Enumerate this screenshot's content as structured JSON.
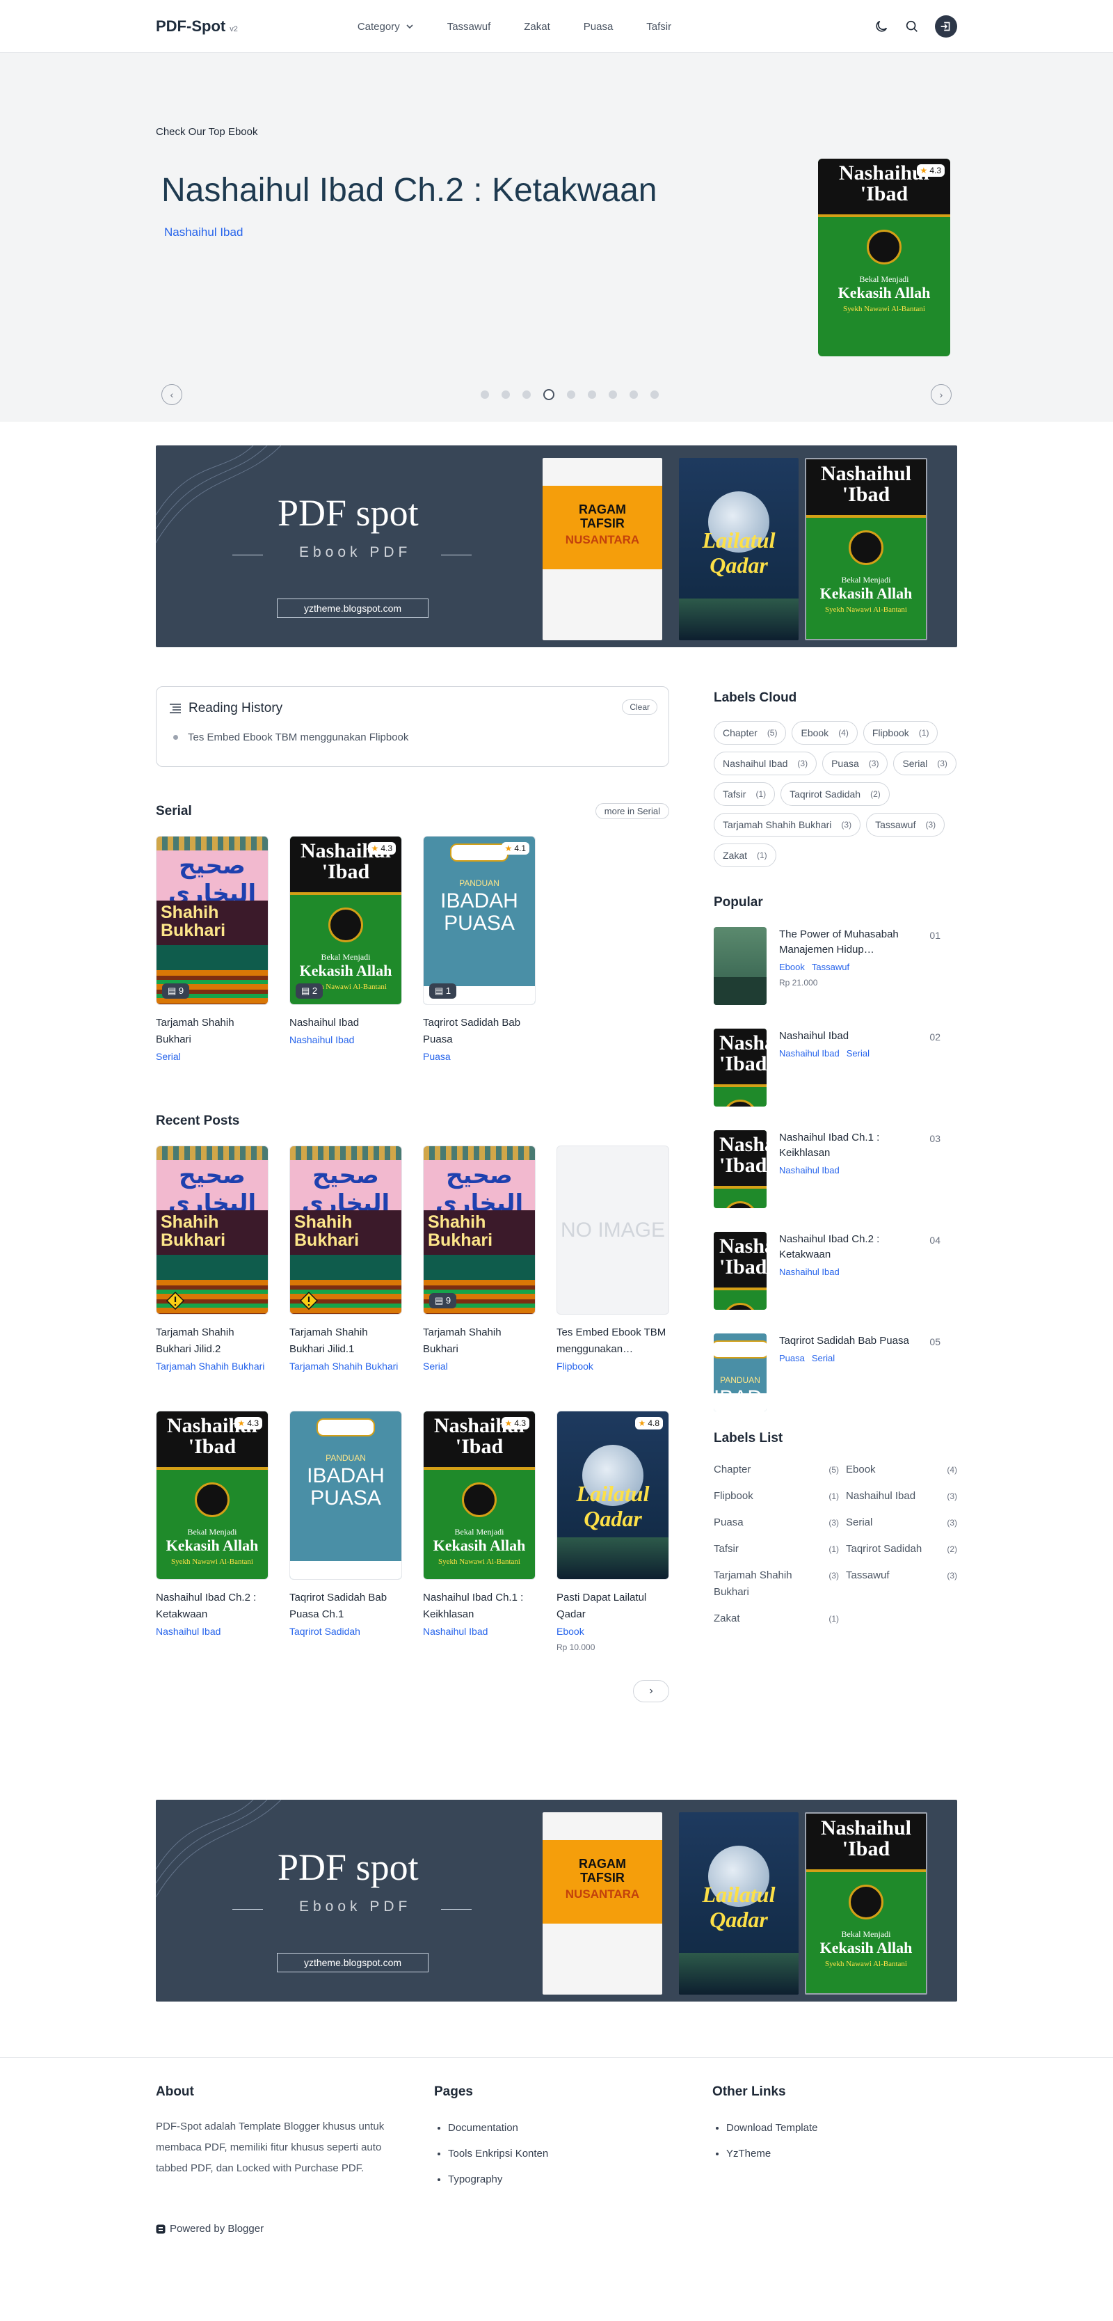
{
  "header": {
    "logo": "PDF-Spot",
    "version": "v2",
    "nav": [
      "Category",
      "Tassawuf",
      "Zakat",
      "Puasa",
      "Tafsir"
    ]
  },
  "hero": {
    "kicker": "Check Our Top Ebook",
    "title": "Nashaihul Ibad Ch.2 : Ketakwaan",
    "label": "Nashaihul Ibad",
    "rating": "4.3",
    "slides": 9,
    "active_slide": 4
  },
  "banner": {
    "title": "PDF spot",
    "subtitle": "Ebook PDF",
    "url": "yztheme.blogspot.com"
  },
  "covers": {
    "bukhari_top": "صحيح البخاري",
    "bukhari_name": "Shahih Bukhari",
    "nashaihul": "Nashaihul 'Ibad",
    "nashaihul_sub": "Bekal Menjadi",
    "nashaihul_main": "Kekasih Allah",
    "nashaihul_author": "Syekh Nawawi Al-Bantani",
    "puasa_small": "PANDUAN",
    "puasa_big1": "IBADAH",
    "puasa_big2": "PUASA",
    "lailatul1": "Lailatul",
    "lailatul2": "Qadar",
    "ragam": "RAGAM TAFSIR",
    "nusantara": "NUSANTARA",
    "no_image": "NO IMAGE"
  },
  "reading_history": {
    "title": "Reading History",
    "clear": "Clear",
    "items": [
      "Tes Embed Ebook TBM menggunakan Flipbook"
    ]
  },
  "serial": {
    "title": "Serial",
    "more": "more in Serial",
    "items": [
      {
        "title": "Tarjamah Shahih Bukhari",
        "label": "Serial",
        "count": "9"
      },
      {
        "title": "Nashaihul Ibad",
        "label": "Nashaihul Ibad",
        "count": "2",
        "rating": "4.3"
      },
      {
        "title": "Taqrirot Sadidah Bab Puasa",
        "label": "Puasa",
        "count": "1",
        "rating": "4.1"
      }
    ]
  },
  "recent": {
    "title": "Recent Posts",
    "items": [
      {
        "title": "Tarjamah Shahih Bukhari Jilid.2",
        "label": "Tarjamah Shahih Bukhari"
      },
      {
        "title": "Tarjamah Shahih Bukhari Jilid.1",
        "label": "Tarjamah Shahih Bukhari"
      },
      {
        "title": "Tarjamah Shahih Bukhari",
        "label": "Serial",
        "count": "9"
      },
      {
        "title": "Tes Embed Ebook TBM menggunakan…",
        "label": "Flipbook"
      },
      {
        "title": "Nashaihul Ibad Ch.2 : Ketakwaan",
        "label": "Nashaihul Ibad",
        "rating": "4.3"
      },
      {
        "title": "Taqrirot Sadidah Bab Puasa Ch.1",
        "label": "Taqrirot Sadidah"
      },
      {
        "title": "Nashaihul Ibad Ch.1 : Keikhlasan",
        "label": "Nashaihul Ibad",
        "rating": "4.3"
      },
      {
        "title": "Pasti Dapat Lailatul Qadar",
        "label": "Ebook",
        "rating": "4.8",
        "price": "Rp 10.000"
      }
    ],
    "next": "›"
  },
  "labels_cloud": {
    "title": "Labels Cloud",
    "items": [
      {
        "name": "Chapter",
        "count": "(5)"
      },
      {
        "name": "Ebook",
        "count": "(4)"
      },
      {
        "name": "Flipbook",
        "count": "(1)"
      },
      {
        "name": "Nashaihul Ibad",
        "count": "(3)"
      },
      {
        "name": "Puasa",
        "count": "(3)"
      },
      {
        "name": "Serial",
        "count": "(3)"
      },
      {
        "name": "Tafsir",
        "count": "(1)"
      },
      {
        "name": "Taqrirot Sadidah",
        "count": "(2)"
      },
      {
        "name": "Tarjamah Shahih Bukhari",
        "count": "(3)"
      },
      {
        "name": "Tassawuf",
        "count": "(3)"
      },
      {
        "name": "Zakat",
        "count": "(1)"
      }
    ]
  },
  "popular": {
    "title": "Popular",
    "items": [
      {
        "title": "The Power of Muhasabah Manajemen Hidup…",
        "labels": [
          "Ebook",
          "Tassawuf"
        ],
        "price": "Rp 21.000",
        "num": "01"
      },
      {
        "title": "Nashaihul Ibad",
        "labels": [
          "Nashaihul Ibad",
          "Serial"
        ],
        "num": "02"
      },
      {
        "title": "Nashaihul Ibad Ch.1 : Keikhlasan",
        "labels": [
          "Nashaihul Ibad"
        ],
        "num": "03"
      },
      {
        "title": "Nashaihul Ibad Ch.2 : Ketakwaan",
        "labels": [
          "Nashaihul Ibad"
        ],
        "num": "04"
      },
      {
        "title": "Taqrirot Sadidah Bab Puasa",
        "labels": [
          "Puasa",
          "Serial"
        ],
        "num": "05"
      }
    ]
  },
  "labels_list": {
    "title": "Labels List",
    "items": [
      {
        "name": "Chapter",
        "count": "(5)"
      },
      {
        "name": "Ebook",
        "count": "(4)"
      },
      {
        "name": "Flipbook",
        "count": "(1)"
      },
      {
        "name": "Nashaihul Ibad",
        "count": "(3)"
      },
      {
        "name": "Puasa",
        "count": "(3)"
      },
      {
        "name": "Serial",
        "count": "(3)"
      },
      {
        "name": "Tafsir",
        "count": "(1)"
      },
      {
        "name": "Taqrirot Sadidah",
        "count": "(2)"
      },
      {
        "name": "Tarjamah Shahih Bukhari",
        "count": "(3)"
      },
      {
        "name": "Tassawuf",
        "count": "(3)"
      },
      {
        "name": "Zakat",
        "count": "(1)"
      }
    ]
  },
  "footer": {
    "about_title": "About",
    "about_text": "PDF-Spot adalah Template Blogger khusus untuk membaca PDF, memiliki fitur khusus seperti auto tabbed PDF, dan Locked with Purchase PDF.",
    "pages_title": "Pages",
    "pages": [
      "Documentation",
      "Tools Enkripsi Konten",
      "Typography"
    ],
    "links_title": "Other Links",
    "links": [
      "Download Template",
      "YzTheme"
    ],
    "powered": "Powered by Blogger"
  },
  "colors": {
    "accent": "#2563eb",
    "banner_bg": "#384657",
    "hero_bg": "#f3f4f5",
    "nashaihul_green": "#1f8a2a"
  }
}
